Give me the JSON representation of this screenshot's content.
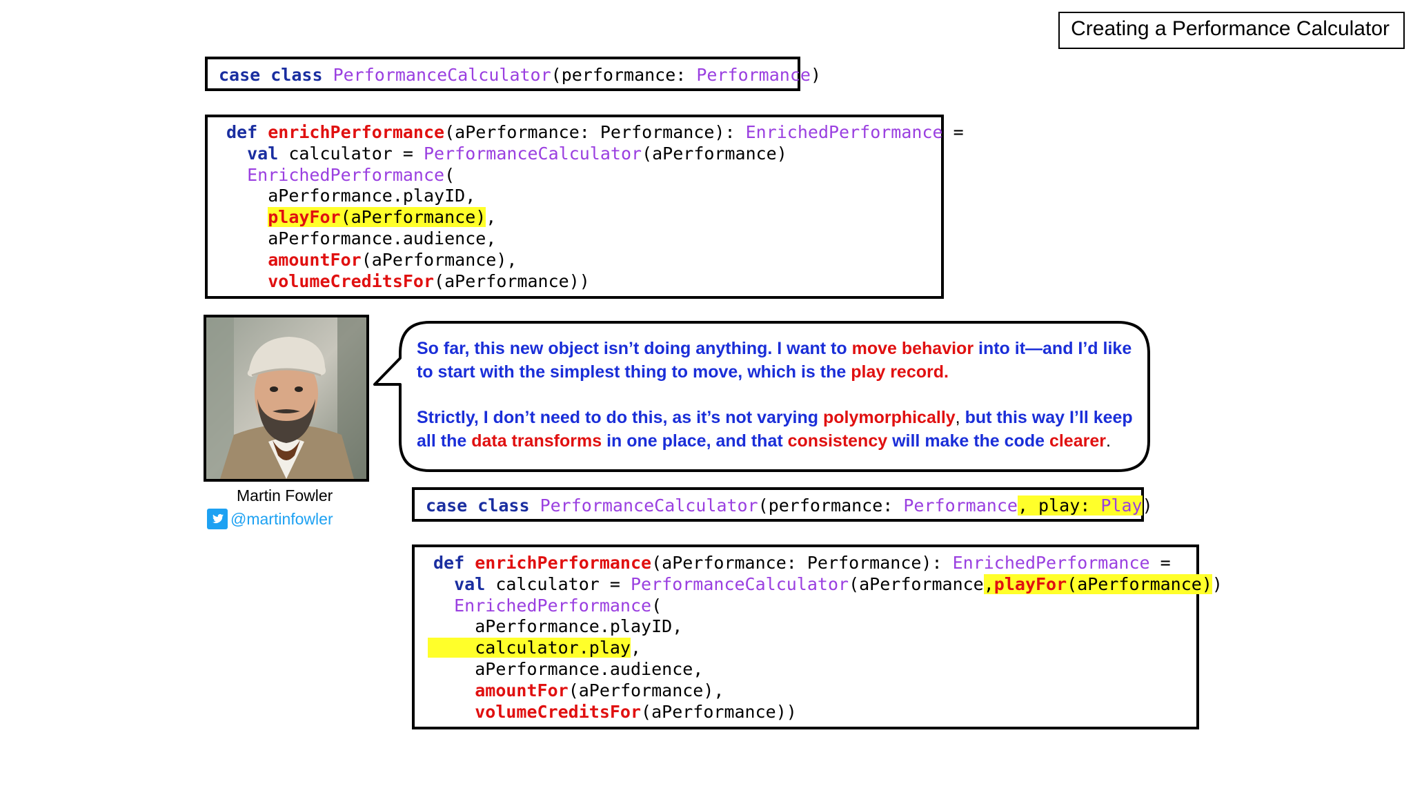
{
  "title": "Creating a Performance Calculator",
  "author": {
    "name": "Martin Fowler",
    "handle": "@martinfowler"
  },
  "code_top": {
    "case_class": {
      "kw": "case class",
      "name": "PerformanceCalculator",
      "params": "(performance: ",
      "type": "Performance",
      "close": ")"
    },
    "def": {
      "line1_kw": "def",
      "line1_fn": "enrichPerformance",
      "line1_params": "(aPerformance: Performance): ",
      "line1_type": "EnrichedPerformance",
      "line1_eq": " =",
      "line2_kw": "val",
      "line2_rest": " calculator = ",
      "line2_type": "PerformanceCalculator",
      "line2_args": "(aPerformance)",
      "line3_type": "EnrichedPerformance",
      "line3_paren": "(",
      "line4": "aPerformance.playID,",
      "line5_fn": "playFor",
      "line5_args": "(aPerformance)",
      "line5_comma": ",",
      "line6": "aPerformance.audience,",
      "line7_fn": "amountFor",
      "line7_args": "(aPerformance),",
      "line8_fn": "volumeCreditsFor",
      "line8_args": "(aPerformance))"
    }
  },
  "bubble": {
    "p1_a": "So far, this new object isn’t doing anything. I want to ",
    "p1_b": "move behavior",
    "p1_c": " into it—and I’d like to start with the simplest thing to move, which is the ",
    "p1_d": "play record",
    "p1_e": ".",
    "p2_a": "Strictly, I don’t need to do this, as it’s not varying ",
    "p2_b": "polymorphically",
    "p2_c": ", ",
    "p2_d": "but this way I’ll keep all the ",
    "p2_e": "data transforms",
    "p2_f": " in one place, and that ",
    "p2_g": "consistency",
    "p2_h": " will make the code ",
    "p2_i": "clearer",
    "p2_j": "."
  },
  "code_bottom": {
    "case_class": {
      "kw": "case class",
      "name": "PerformanceCalculator",
      "params": "(performance: ",
      "type": "Performance",
      "extra_a": ", play: ",
      "extra_type": "Play",
      "close": ")"
    },
    "def": {
      "line1_kw": "def",
      "line1_fn": "enrichPerformance",
      "line1_params": "(aPerformance: Performance): ",
      "line1_type": "EnrichedPerformance",
      "line1_eq": " =",
      "line2_kw": "val",
      "line2_rest": " calculator = ",
      "line2_type": "PerformanceCalculator",
      "line2_args": "(aPerformance",
      "line2_hl_comma": ",",
      "line2_hl_fn": "playFor",
      "line2_hl_args": "(aPerformance)",
      "line2_close": ")",
      "line3_type": "EnrichedPerformance",
      "line3_paren": "(",
      "line4": "aPerformance.playID,",
      "line5_hl": "calculator.play",
      "line5_comma": ",",
      "line6": "aPerformance.audience,",
      "line7_fn": "amountFor",
      "line7_args": "(aPerformance),",
      "line8_fn": "volumeCreditsFor",
      "line8_args": "(aPerformance))"
    }
  },
  "colors": {
    "keyword": "#1a2ea0",
    "type": "#9a3fe0",
    "function": "#e01010",
    "highlight": "#ffff2a",
    "bubble_text": "#1a2ed8",
    "twitter": "#1da1f2"
  }
}
